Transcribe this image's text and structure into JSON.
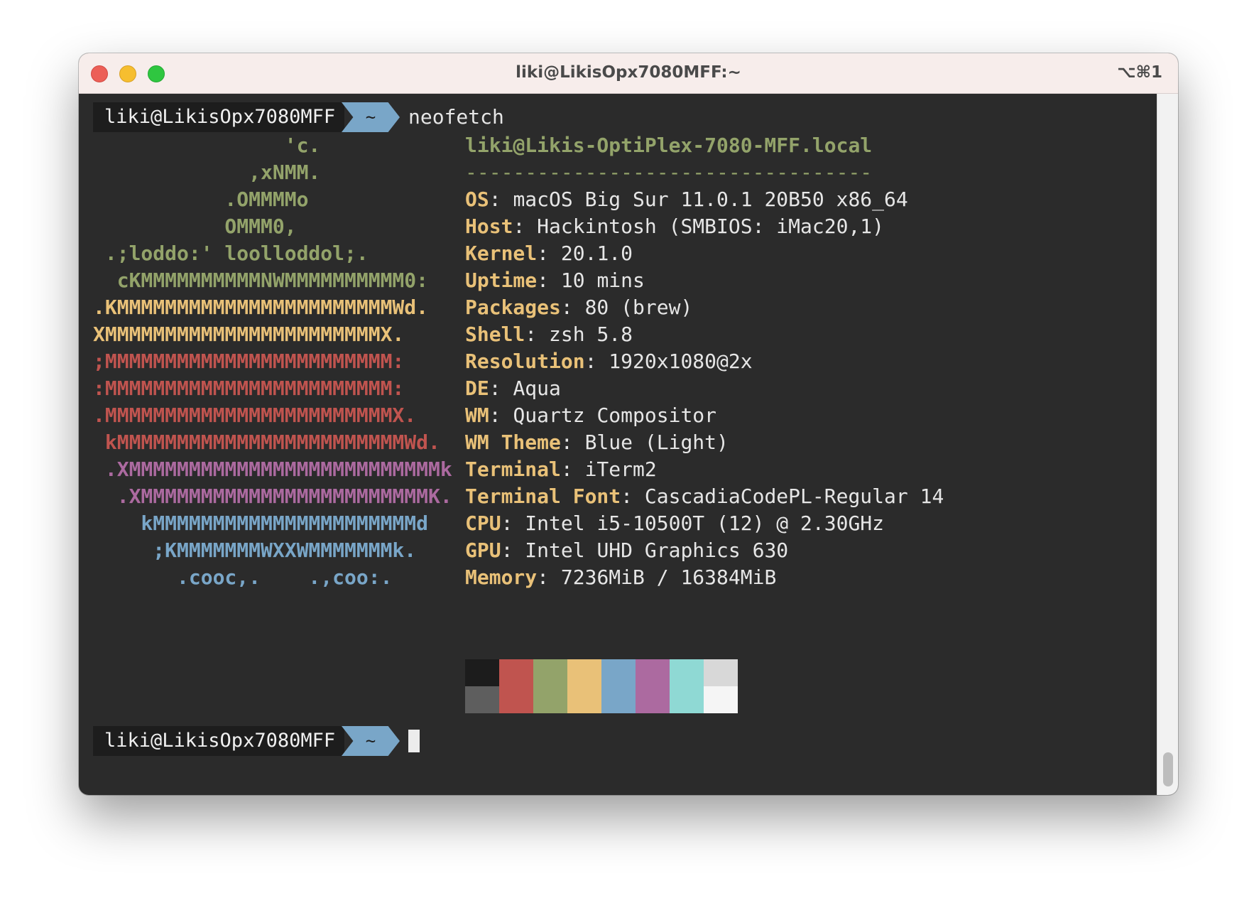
{
  "window": {
    "title": "liki@LikisOpx7080MFF:~",
    "shortcut": "⌥⌘1"
  },
  "prompt": {
    "user": "liki@LikisOpx7080MFF",
    "dir": "~",
    "command": "neofetch"
  },
  "logo": [
    {
      "text": "                'c.",
      "color": "#93a36a"
    },
    {
      "text": "             ,xNMM.",
      "color": "#93a36a"
    },
    {
      "text": "           .OMMMMo",
      "color": "#93a36a"
    },
    {
      "text": "           OMMM0,",
      "color": "#93a36a"
    },
    {
      "text": " .;loddo:' loolloddol;.",
      "color": "#93a36a"
    },
    {
      "text": "  cKMMMMMMMMMMNWMMMMMMMMMM0:",
      "color": "#93a36a"
    },
    {
      "text": ".KMMMMMMMMMMMMMMMMMMMMMMMWd.",
      "color": "#e9c178"
    },
    {
      "text": "XMMMMMMMMMMMMMMMMMMMMMMMX.",
      "color": "#e9c178"
    },
    {
      "text": ";MMMMMMMMMMMMMMMMMMMMMMMM:",
      "color": "#c0544f"
    },
    {
      "text": ":MMMMMMMMMMMMMMMMMMMMMMMM:",
      "color": "#c0544f"
    },
    {
      "text": ".MMMMMMMMMMMMMMMMMMMMMMMMX.",
      "color": "#c0544f"
    },
    {
      "text": " kMMMMMMMMMMMMMMMMMMMMMMMMWd.",
      "color": "#c0544f"
    },
    {
      "text": " .XMMMMMMMMMMMMMMMMMMMMMMMMMMk",
      "color": "#ac6aa0"
    },
    {
      "text": "  .XMMMMMMMMMMMMMMMMMMMMMMMMK.",
      "color": "#ac6aa0"
    },
    {
      "text": "    kMMMMMMMMMMMMMMMMMMMMMMd",
      "color": "#79a6c8"
    },
    {
      "text": "     ;KMMMMMMMWXXWMMMMMMMk.",
      "color": "#79a6c8"
    },
    {
      "text": "       .cooc,.    .,coo:.",
      "color": "#79a6c8"
    }
  ],
  "info": {
    "header": "liki@Likis-OptiPlex-7080-MFF.local",
    "separator": "----------------------------------",
    "rows": [
      {
        "key": "OS",
        "value": "macOS Big Sur 11.0.1 20B50 x86_64"
      },
      {
        "key": "Host",
        "value": "Hackintosh (SMBIOS: iMac20,1)"
      },
      {
        "key": "Kernel",
        "value": "20.1.0"
      },
      {
        "key": "Uptime",
        "value": "10 mins"
      },
      {
        "key": "Packages",
        "value": "80 (brew)"
      },
      {
        "key": "Shell",
        "value": "zsh 5.8"
      },
      {
        "key": "Resolution",
        "value": "1920x1080@2x"
      },
      {
        "key": "DE",
        "value": "Aqua"
      },
      {
        "key": "WM",
        "value": "Quartz Compositor"
      },
      {
        "key": "WM Theme",
        "value": "Blue (Light)"
      },
      {
        "key": "Terminal",
        "value": "iTerm2"
      },
      {
        "key": "Terminal Font",
        "value": "CascadiaCodePL-Regular 14"
      },
      {
        "key": "CPU",
        "value": "Intel i5-10500T (12) @ 2.30GHz"
      },
      {
        "key": "GPU",
        "value": "Intel UHD Graphics 630"
      },
      {
        "key": "Memory",
        "value": "7236MiB / 16384MiB"
      }
    ]
  },
  "palette": {
    "normal": [
      "#1c1c1c",
      "#c0544f",
      "#93a36a",
      "#e9c178",
      "#79a6c8",
      "#ac6aa0",
      "#8fd9d4",
      "#d8d8d8"
    ],
    "bright": [
      "#5e5e5e",
      "#c0544f",
      "#93a36a",
      "#e9c178",
      "#79a6c8",
      "#ac6aa0",
      "#8fd9d4",
      "#f5f5f5"
    ]
  },
  "prompt2": {
    "user": "liki@LikisOpx7080MFF",
    "dir": "~"
  }
}
